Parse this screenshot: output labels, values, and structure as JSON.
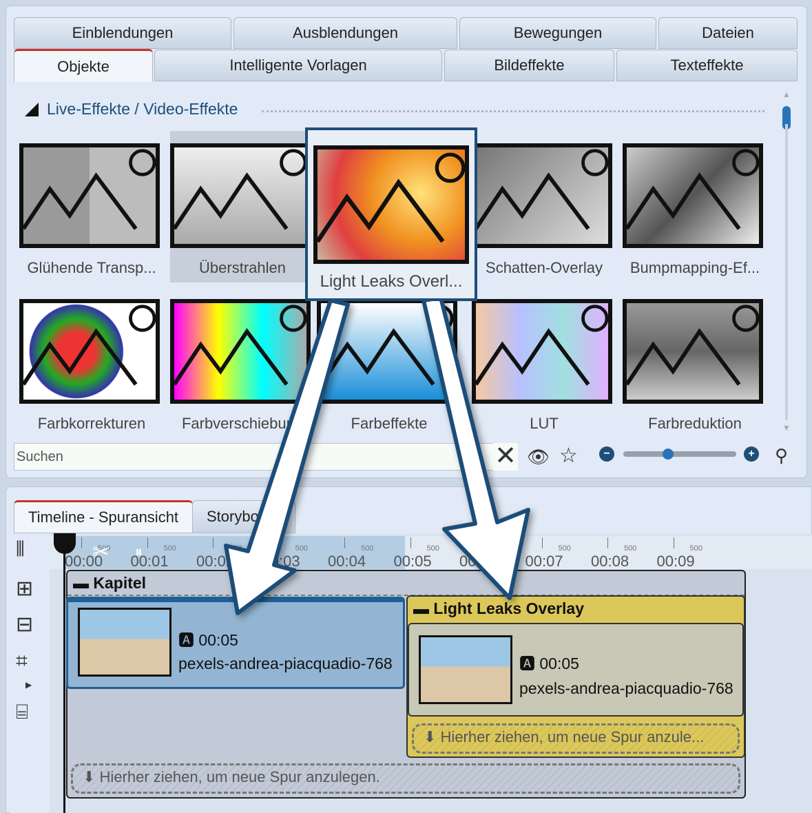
{
  "tabs_row1": [
    "Einblendungen",
    "Ausblendungen",
    "Bewegungen",
    "Dateien"
  ],
  "tabs_row2": [
    "Objekte",
    "Intelligente Vorlagen",
    "Bildeffekte",
    "Texteffekte"
  ],
  "section_title": "Live-Effekte / Video-Effekte",
  "effects": [
    {
      "label": "Glühende Transp..."
    },
    {
      "label": "Überstrahlen"
    },
    {
      "label": "Light Leaks Overl...",
      "selected": true
    },
    {
      "label": "Schatten-Overlay"
    },
    {
      "label": "Bumpmapping-Ef..."
    },
    {
      "label": "Farbkorrekturen"
    },
    {
      "label": "Farbverschiebung"
    },
    {
      "label": "Farbeffekte"
    },
    {
      "label": "LUT"
    },
    {
      "label": "Farbreduktion"
    }
  ],
  "search": {
    "placeholder": "Suchen"
  },
  "zoom_slider": {
    "value": 0.3
  },
  "timeline": {
    "tabs": [
      "Timeline - Spuransicht",
      "Storyboard"
    ],
    "ruler_labels": [
      "00:00",
      "00:01",
      "00:02",
      "00:03",
      "00:04",
      "00:05",
      "00:06",
      "00:07",
      "00:08",
      "00:09"
    ],
    "ruler_sub": "500",
    "chapter": "Kapitel",
    "clip1": {
      "duration": "00:05",
      "name": "pexels-andrea-piacquadio-768"
    },
    "overlay": {
      "title": "Light Leaks Overlay",
      "duration": "00:05",
      "name": "pexels-andrea-piacquadio-768",
      "drop": "Hierher ziehen, um neue Spur anzule..."
    },
    "drop": "Hierher ziehen, um neue Spur anzulegen."
  },
  "colors": {
    "accent": "#1f4e79",
    "overlay_yellow": "#dcc85a",
    "clip_blue": "#8fb3d3"
  }
}
